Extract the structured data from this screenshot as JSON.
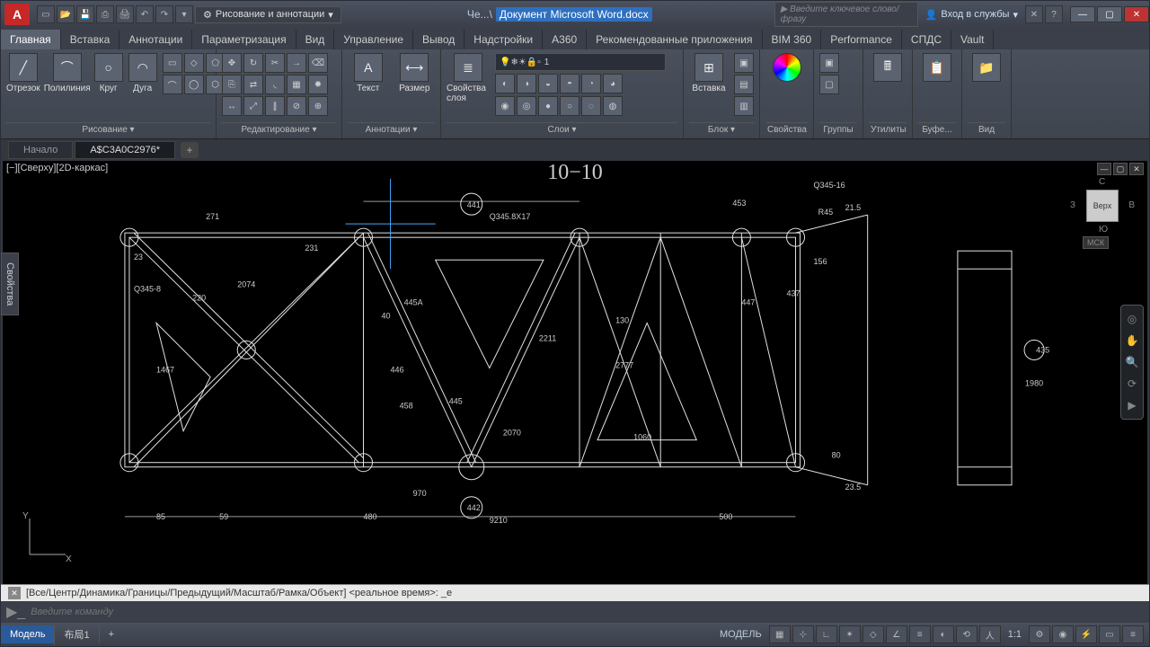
{
  "app": {
    "logo": "A"
  },
  "qat_icons": [
    "new",
    "open",
    "save",
    "saveas",
    "plot",
    "undo",
    "redo"
  ],
  "workspace": {
    "label": "Рисование и аннотации"
  },
  "title": {
    "prefix": "Че...\\",
    "doc": "Документ Microsoft Word.docx"
  },
  "search": {
    "placeholder": "Введите ключевое слово/фразу"
  },
  "signin": {
    "label": "Вход в службы"
  },
  "ribbon_tabs": [
    "Главная",
    "Вставка",
    "Аннотации",
    "Параметризация",
    "Вид",
    "Управление",
    "Вывод",
    "Надстройки",
    "A360",
    "Рекомендованные приложения",
    "BIM 360",
    "Performance",
    "СПДС",
    "Vault"
  ],
  "active_ribbon": 0,
  "panels": {
    "draw": {
      "label": "Рисование ▾",
      "tools": [
        {
          "n": "Отрезок",
          "i": "╱"
        },
        {
          "n": "Полилиния",
          "i": "⌒"
        },
        {
          "n": "Круг",
          "i": "○"
        },
        {
          "n": "Дуга",
          "i": "◠"
        }
      ]
    },
    "modify": {
      "label": "Редактирование ▾"
    },
    "annot": {
      "label": "Аннотации ▾",
      "tools": [
        {
          "n": "Текст",
          "i": "A"
        },
        {
          "n": "Размер",
          "i": "⟷"
        }
      ]
    },
    "layers": {
      "label": "Слои ▾",
      "current": "1",
      "tool": "Свойства слоя"
    },
    "block": {
      "label": "Блок ▾",
      "tool": "Вставка"
    },
    "props": {
      "label": "Свойства"
    },
    "groups": {
      "label": "Группы"
    },
    "util": {
      "label": "Утилиты"
    },
    "clip": {
      "label": "Буфе..."
    },
    "view": {
      "label": "Вид"
    }
  },
  "doc_tabs": [
    {
      "label": "Начало",
      "active": false
    },
    {
      "label": "A$C3A0C2976*",
      "active": true
    }
  ],
  "canvas": {
    "header": "[−][Сверху][2D-каркас]",
    "title": "10−10"
  },
  "viewcube": {
    "face": "Верх",
    "n": "С",
    "s": "Ю",
    "e": "В",
    "w": "З",
    "cs": "МСК"
  },
  "drawing_labels": [
    "271",
    "231",
    "220",
    "2074",
    "1467",
    "Q345-8",
    "445A",
    "446",
    "458",
    "445",
    "441",
    "442",
    "453",
    "447",
    "437",
    "156",
    "435",
    "85",
    "59",
    "480",
    "40",
    "970",
    "2070",
    "1060",
    "80",
    "500",
    "R45",
    "21.5",
    "23.5",
    "1980",
    "Q345-16",
    "130",
    "2777",
    "2211",
    "23",
    "Q345.8X17",
    "9210"
  ],
  "cmd": {
    "history": "[Все/Центр/Динамика/Границы/Предыдущий/Масштаб/Рамка/Объект] <реальное время>: _e",
    "placeholder": "Введите команду"
  },
  "status": {
    "model": "Модель",
    "layout": "布局1",
    "model_btn": "МОДЕЛЬ",
    "scale": "1:1"
  },
  "props_tab": "Свойства"
}
